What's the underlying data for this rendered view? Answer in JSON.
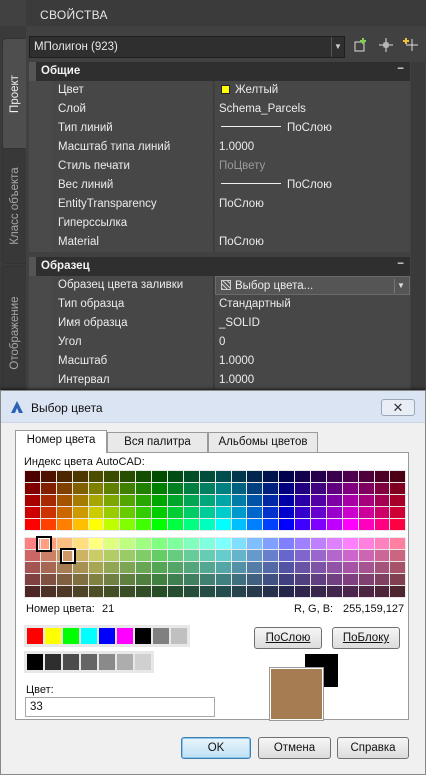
{
  "palette": {
    "title": "СВОЙСТВА",
    "vtabs": [
      "Проект",
      "Класс объекта",
      "Отображение"
    ],
    "object_selector": "МПолигон (923)",
    "toolbar_icons": [
      "quick-select-icon",
      "select-objects-icon",
      "toggle-pickadd-icon"
    ],
    "sections": [
      {
        "title": "Общие",
        "rows": [
          {
            "key": "Цвет",
            "value": "Желтый"
          },
          {
            "key": "Слой",
            "value": "Schema_Parcels"
          },
          {
            "key": "Тип линий",
            "value": "ПоСлою"
          },
          {
            "key": "Масштаб типа линий",
            "value": "1.0000"
          },
          {
            "key": "Стиль печати",
            "value": "ПоЦвету"
          },
          {
            "key": "Вес линий",
            "value": "ПоСлою"
          },
          {
            "key": "EntityTransparency",
            "value": "ПоСлою"
          },
          {
            "key": "Гиперссылка",
            "value": ""
          },
          {
            "key": "Material",
            "value": "ПоСлою"
          }
        ]
      },
      {
        "title": "Образец",
        "rows": [
          {
            "key": "Образец цвета заливки",
            "value": "Выбор цвета..."
          },
          {
            "key": "Тип образца",
            "value": "Стандартный"
          },
          {
            "key": "Имя образца",
            "value": "_SOLID"
          },
          {
            "key": "Угол",
            "value": "0"
          },
          {
            "key": "Масштаб",
            "value": "1.0000"
          },
          {
            "key": "Интервал",
            "value": "1.0000"
          }
        ]
      }
    ],
    "color_swatch": "#ffff00",
    "collapse_symbol": "−"
  },
  "dialog": {
    "title": "Выбор цвета",
    "close": "✕",
    "tabs": [
      "Номер цвета",
      "Вся палитра",
      "Альбомы цветов"
    ],
    "index_label": "Индекс цвета AutoCAD:",
    "number_label": "Номер цвета:",
    "number_value": "21",
    "rgb_label": "R, G, B:",
    "rgb_value": "255,159,127",
    "bylayer": "ПоСлою",
    "byblock": "ПоБлоку",
    "color_label": "Цвет:",
    "color_value": "33",
    "ok": "OK",
    "cancel": "Отмена",
    "help": "Справка",
    "std_colors": [
      "#ff0000",
      "#ffff00",
      "#00ff00",
      "#00ffff",
      "#0000ff",
      "#ff00ff",
      "#000000",
      "#808080",
      "#c0c0c0"
    ],
    "gray_colors": [
      "#000000",
      "#2e2e2e",
      "#4c4c4c",
      "#656565",
      "#8a8a8a",
      "#adadad",
      "#d0d0d0"
    ],
    "preview_color": "#a67d52",
    "previous_color": "#000000"
  }
}
